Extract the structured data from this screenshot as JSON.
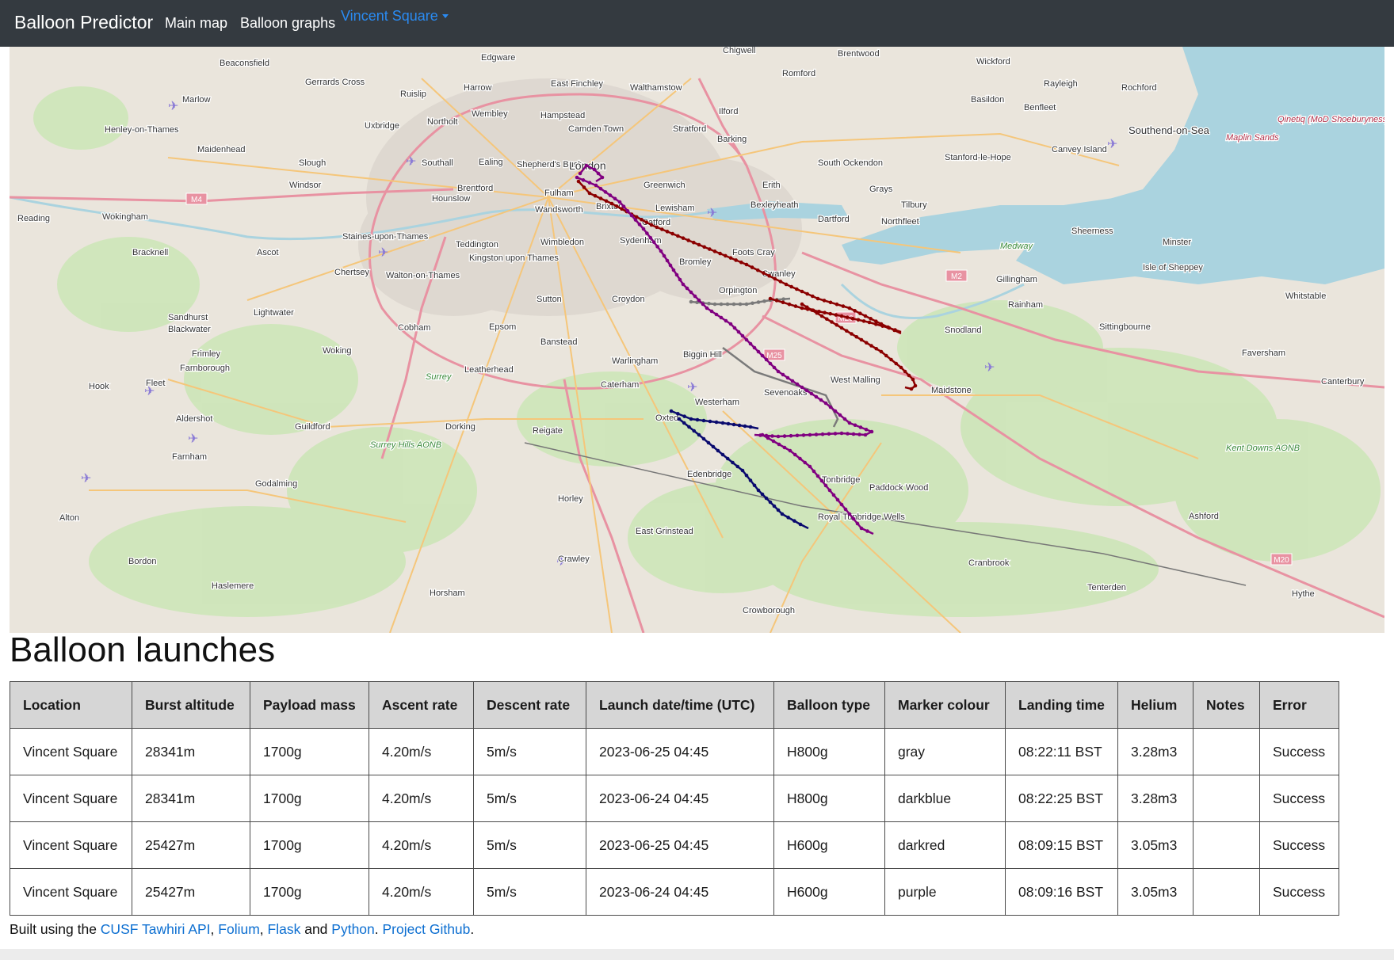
{
  "navbar": {
    "brand": "Balloon Predictor",
    "links": [
      "Main map",
      "Balloon graphs"
    ],
    "dropdown_label": "Vincent Square"
  },
  "map": {
    "place_labels": [
      "Beaconsfield",
      "Gerrards Cross",
      "Edgware",
      "Chigwell",
      "Brentwood",
      "Wickford",
      "Rayleigh",
      "Rochford",
      "Marlow",
      "Ruislip",
      "Harrow",
      "East Finchley",
      "Walthamstow",
      "Romford",
      "Basildon",
      "Benfleet",
      "Henley-on-Thames",
      "Uxbridge",
      "Northolt",
      "Wembley",
      "Hampstead",
      "Camden Town",
      "Ilford",
      "Stratford",
      "Barking",
      "Southend-on-Sea",
      "Maidenhead",
      "Slough",
      "Southall",
      "Ealing",
      "Shepherd's Bush",
      "London",
      "Canvey Island",
      "Stanford-le-Hope",
      "South Ockendon",
      "Windsor",
      "Brentford",
      "Fulham",
      "Greenwich",
      "Erith",
      "Grays",
      "Tilbury",
      "Reading",
      "Wokingham",
      "Hounslow",
      "Wandsworth",
      "Brixton",
      "Lewisham",
      "Bexleyheath",
      "Dartford",
      "Northfleet",
      "Staines-upon-Thames",
      "Teddington",
      "Kingston upon Thames",
      "Wimbledon",
      "Catford",
      "Sydenham",
      "Foots Cray",
      "Sheerness",
      "Minster",
      "Bracknell",
      "Ascot",
      "Chertsey",
      "Walton-on-Thames",
      "Bromley",
      "Swanley",
      "Gillingham",
      "Isle of Sheppey",
      "Orpington",
      "Rainham",
      "Whitstable",
      "Sandhurst",
      "Blackwater",
      "Lightwater",
      "Cobham",
      "Sutton",
      "Croydon",
      "Epsom",
      "Banstead",
      "Snodland",
      "Sittingbourne",
      "Frimley",
      "Woking",
      "Biggin Hill",
      "Warlingham",
      "Faversham",
      "Farnborough",
      "Leatherhead",
      "Hook",
      "Fleet",
      "West Malling",
      "Maidstone",
      "Canterbury",
      "Caterham",
      "Sevenoaks",
      "Westerham",
      "Oxted",
      "Aldershot",
      "Guildford",
      "Dorking",
      "Reigate",
      "Surrey Hills AONB",
      "Kent Downs AONB",
      "Farnham",
      "Edenbridge",
      "Tonbridge",
      "Paddock Wood",
      "Godalming",
      "Horley",
      "Royal Tunbridge Wells",
      "Ashford",
      "Alton",
      "East Grinstead",
      "Crawley",
      "Bordon",
      "Cranbrook",
      "Haslemere",
      "Tenterden",
      "Horsham",
      "Crowborough",
      "Hythe",
      "Medway",
      "Qinetiq (MoD Shoeburyness)",
      "Maplin Sands",
      "Surrey"
    ],
    "road_labels": [
      "M4",
      "M2",
      "M20",
      "M25",
      "M20"
    ],
    "track_colors": {
      "gray": "#7a7a7a",
      "darkblue": "#0a0a6e",
      "darkred": "#8b0000",
      "purple": "#800080"
    }
  },
  "section_title": "Balloon launches",
  "table": {
    "headers": [
      "Location",
      "Burst altitude",
      "Payload mass",
      "Ascent rate",
      "Descent rate",
      "Launch date/time (UTC)",
      "Balloon type",
      "Marker colour",
      "Landing time",
      "Helium",
      "Notes",
      "Error"
    ],
    "rows": [
      [
        "Vincent Square",
        "28341m",
        "1700g",
        "4.20m/s",
        "5m/s",
        "2023-06-25 04:45",
        "H800g",
        "gray",
        "08:22:11 BST",
        "3.28m3",
        "",
        "Success"
      ],
      [
        "Vincent Square",
        "28341m",
        "1700g",
        "4.20m/s",
        "5m/s",
        "2023-06-24 04:45",
        "H800g",
        "darkblue",
        "08:22:25 BST",
        "3.28m3",
        "",
        "Success"
      ],
      [
        "Vincent Square",
        "25427m",
        "1700g",
        "4.20m/s",
        "5m/s",
        "2023-06-25 04:45",
        "H600g",
        "darkred",
        "08:09:15 BST",
        "3.05m3",
        "",
        "Success"
      ],
      [
        "Vincent Square",
        "25427m",
        "1700g",
        "4.20m/s",
        "5m/s",
        "2023-06-24 04:45",
        "H600g",
        "purple",
        "08:09:16 BST",
        "3.05m3",
        "",
        "Success"
      ]
    ]
  },
  "footer": {
    "prefix": "Built using the ",
    "link1": "CUSF Tawhiri API",
    "sep1": ", ",
    "link2": "Folium",
    "sep2": ", ",
    "link3": "Flask",
    "sep3": " and ",
    "link4": "Python",
    "sep4": ". ",
    "link5": "Project Github",
    "suffix": "."
  }
}
